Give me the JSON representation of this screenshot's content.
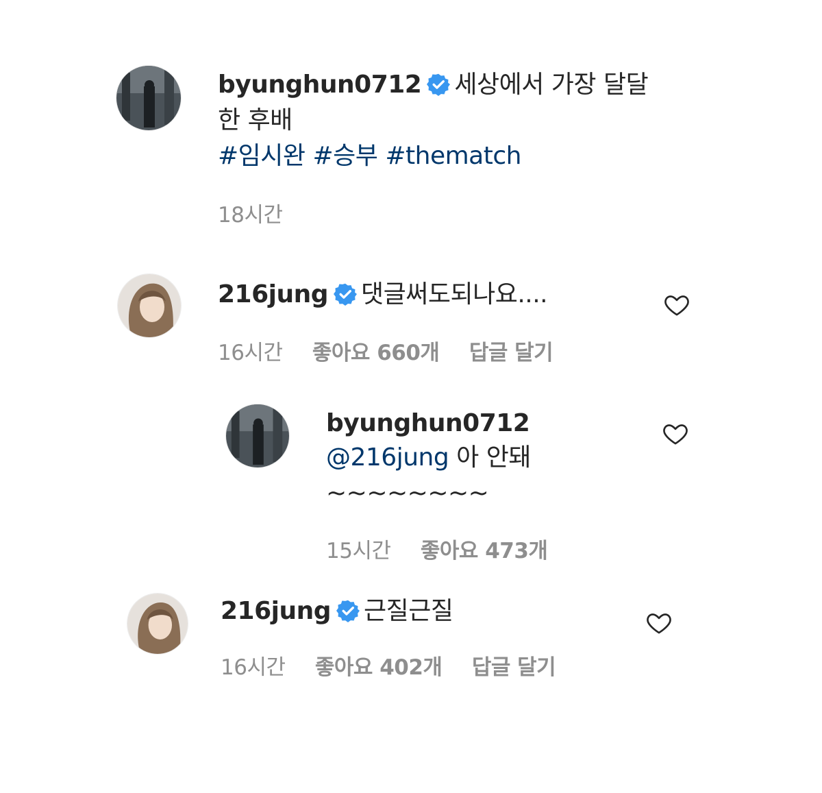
{
  "post": {
    "username": "byunghun0712",
    "caption_line1": "세상에서 가장 달달",
    "caption_line2": "한 후배",
    "hashtags": [
      "#임시완",
      "#승부",
      "#thematch"
    ],
    "time": "18시간"
  },
  "comments": [
    {
      "username": "216jung",
      "text": "댓글써도되나요....",
      "time": "16시간",
      "likes": "좋아요 660개",
      "reply_label": "답글 달기"
    },
    {
      "username": "byunghun0712",
      "mention": "@216jung",
      "text": "아 안돼",
      "text_line2": "~~~~~~~~",
      "time": "15시간",
      "likes": "좋아요 473개"
    },
    {
      "username": "216jung",
      "text": "근질근질",
      "time": "16시간",
      "likes": "좋아요 402개",
      "reply_label": "답글 달기"
    }
  ],
  "icons": {
    "verified": "verified-badge-icon",
    "like": "heart-outline-icon"
  },
  "colors": {
    "verified": "#3897f0",
    "hashtag": "#00376b",
    "secondary_text": "#8e8e8e",
    "primary_text": "#262626"
  }
}
